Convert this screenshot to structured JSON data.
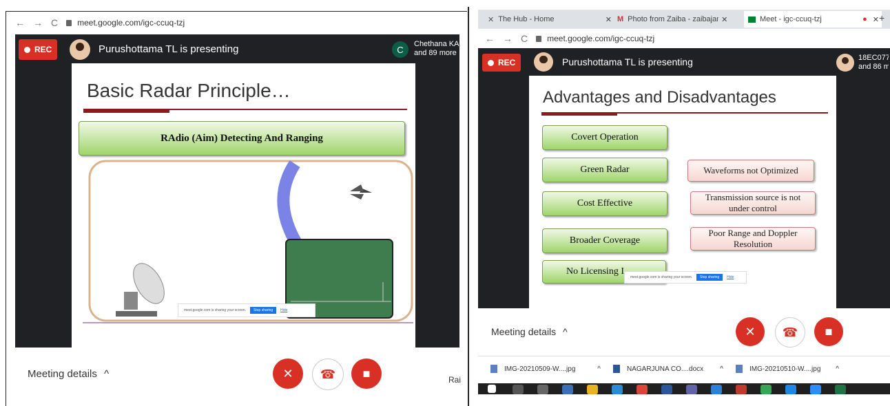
{
  "left": {
    "url": "meet.google.com/igc-ccuq-tzj",
    "rec_label": "REC",
    "presenting_text": "Purushottama TL is presenting",
    "participant_initial": "C",
    "participant_name": "Chethana KA",
    "participant_more": "and 89 more",
    "slide": {
      "title": "Basic Radar Principle…",
      "banner": "RAdio (Aim) Detecting And Ranging"
    },
    "share_text": "meet.google.com is sharing your screen.",
    "stop_sharing": "Stop sharing",
    "hide": "Hide",
    "meeting_details": "Meeting details",
    "right_edge_text": "Rai"
  },
  "right": {
    "tabs": [
      {
        "title": "The Hub - Home"
      },
      {
        "title": "Photo from Zaiba - zaibajameel@"
      },
      {
        "title": "Meet - igc-ccuq-tzj"
      }
    ],
    "url": "meet.google.com/igc-ccuq-tzj",
    "rec_label": "REC",
    "presenting_text": "Purushottama TL is presenting",
    "participant_name": "18EC077",
    "participant_more": "and 86 m",
    "slide": {
      "title": "Advantages and Disadvantages",
      "advantages": [
        "Covert Operation",
        "Green Radar",
        "Cost Effective",
        "Broader Coverage",
        "No Licensing I"
      ],
      "disadvantages": [
        "Waveforms not Optimized",
        "Transmission source is not under control",
        "Poor Range and Doppler Resolution"
      ]
    },
    "share_text": "meet.google.com is sharing your screen.",
    "stop_sharing": "Stop sharing",
    "hide": "Hide",
    "meeting_details": "Meeting details",
    "downloads": [
      {
        "name": "IMG-20210509-W....jpg"
      },
      {
        "name": "NAGARJUNA CO....docx"
      },
      {
        "name": "IMG-20210510-W....jpg"
      }
    ]
  },
  "colors": {
    "meet_black": "#202124",
    "rec_red": "#d93025",
    "slide_green": "#9fd56b",
    "banner_rule": "#8b1a1a"
  }
}
